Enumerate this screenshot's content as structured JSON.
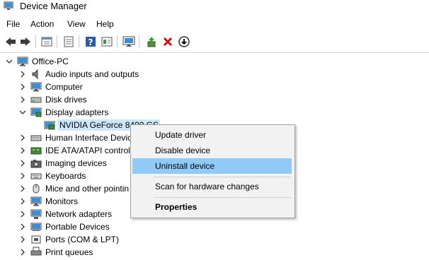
{
  "window": {
    "title": "Device Manager"
  },
  "menu": [
    "File",
    "Action",
    "View",
    "Help"
  ],
  "toolbar": [
    "back-icon",
    "forward-icon",
    "properties-icon",
    "help-icon",
    "update-icon",
    "view-icon",
    "monitor-icon",
    "add-driver-icon",
    "delete-icon",
    "download-icon"
  ],
  "tree": {
    "root": "Office-PC",
    "items": [
      {
        "label": "Audio inputs and outputs",
        "expanded": false
      },
      {
        "label": "Computer",
        "expanded": false
      },
      {
        "label": "Disk drives",
        "expanded": false
      },
      {
        "label": "Display adapters",
        "expanded": true
      },
      {
        "label": "NVIDIA GeForce 8400 GS",
        "child": true,
        "selected": true
      },
      {
        "label": "Human Interface Devic",
        "expanded": false
      },
      {
        "label": "IDE ATA/ATAPI control",
        "expanded": false
      },
      {
        "label": "Imaging devices",
        "expanded": false
      },
      {
        "label": "Keyboards",
        "expanded": false
      },
      {
        "label": "Mice and other pointin",
        "expanded": false
      },
      {
        "label": "Monitors",
        "expanded": false
      },
      {
        "label": "Network adapters",
        "expanded": false
      },
      {
        "label": "Portable Devices",
        "expanded": false
      },
      {
        "label": "Ports (COM & LPT)",
        "expanded": false
      },
      {
        "label": "Print queues",
        "expanded": false
      }
    ]
  },
  "context_menu": {
    "items": [
      "Update driver",
      "Disable device",
      "Uninstall device",
      "Scan for hardware changes",
      "Properties"
    ],
    "highlighted": "Uninstall device"
  }
}
